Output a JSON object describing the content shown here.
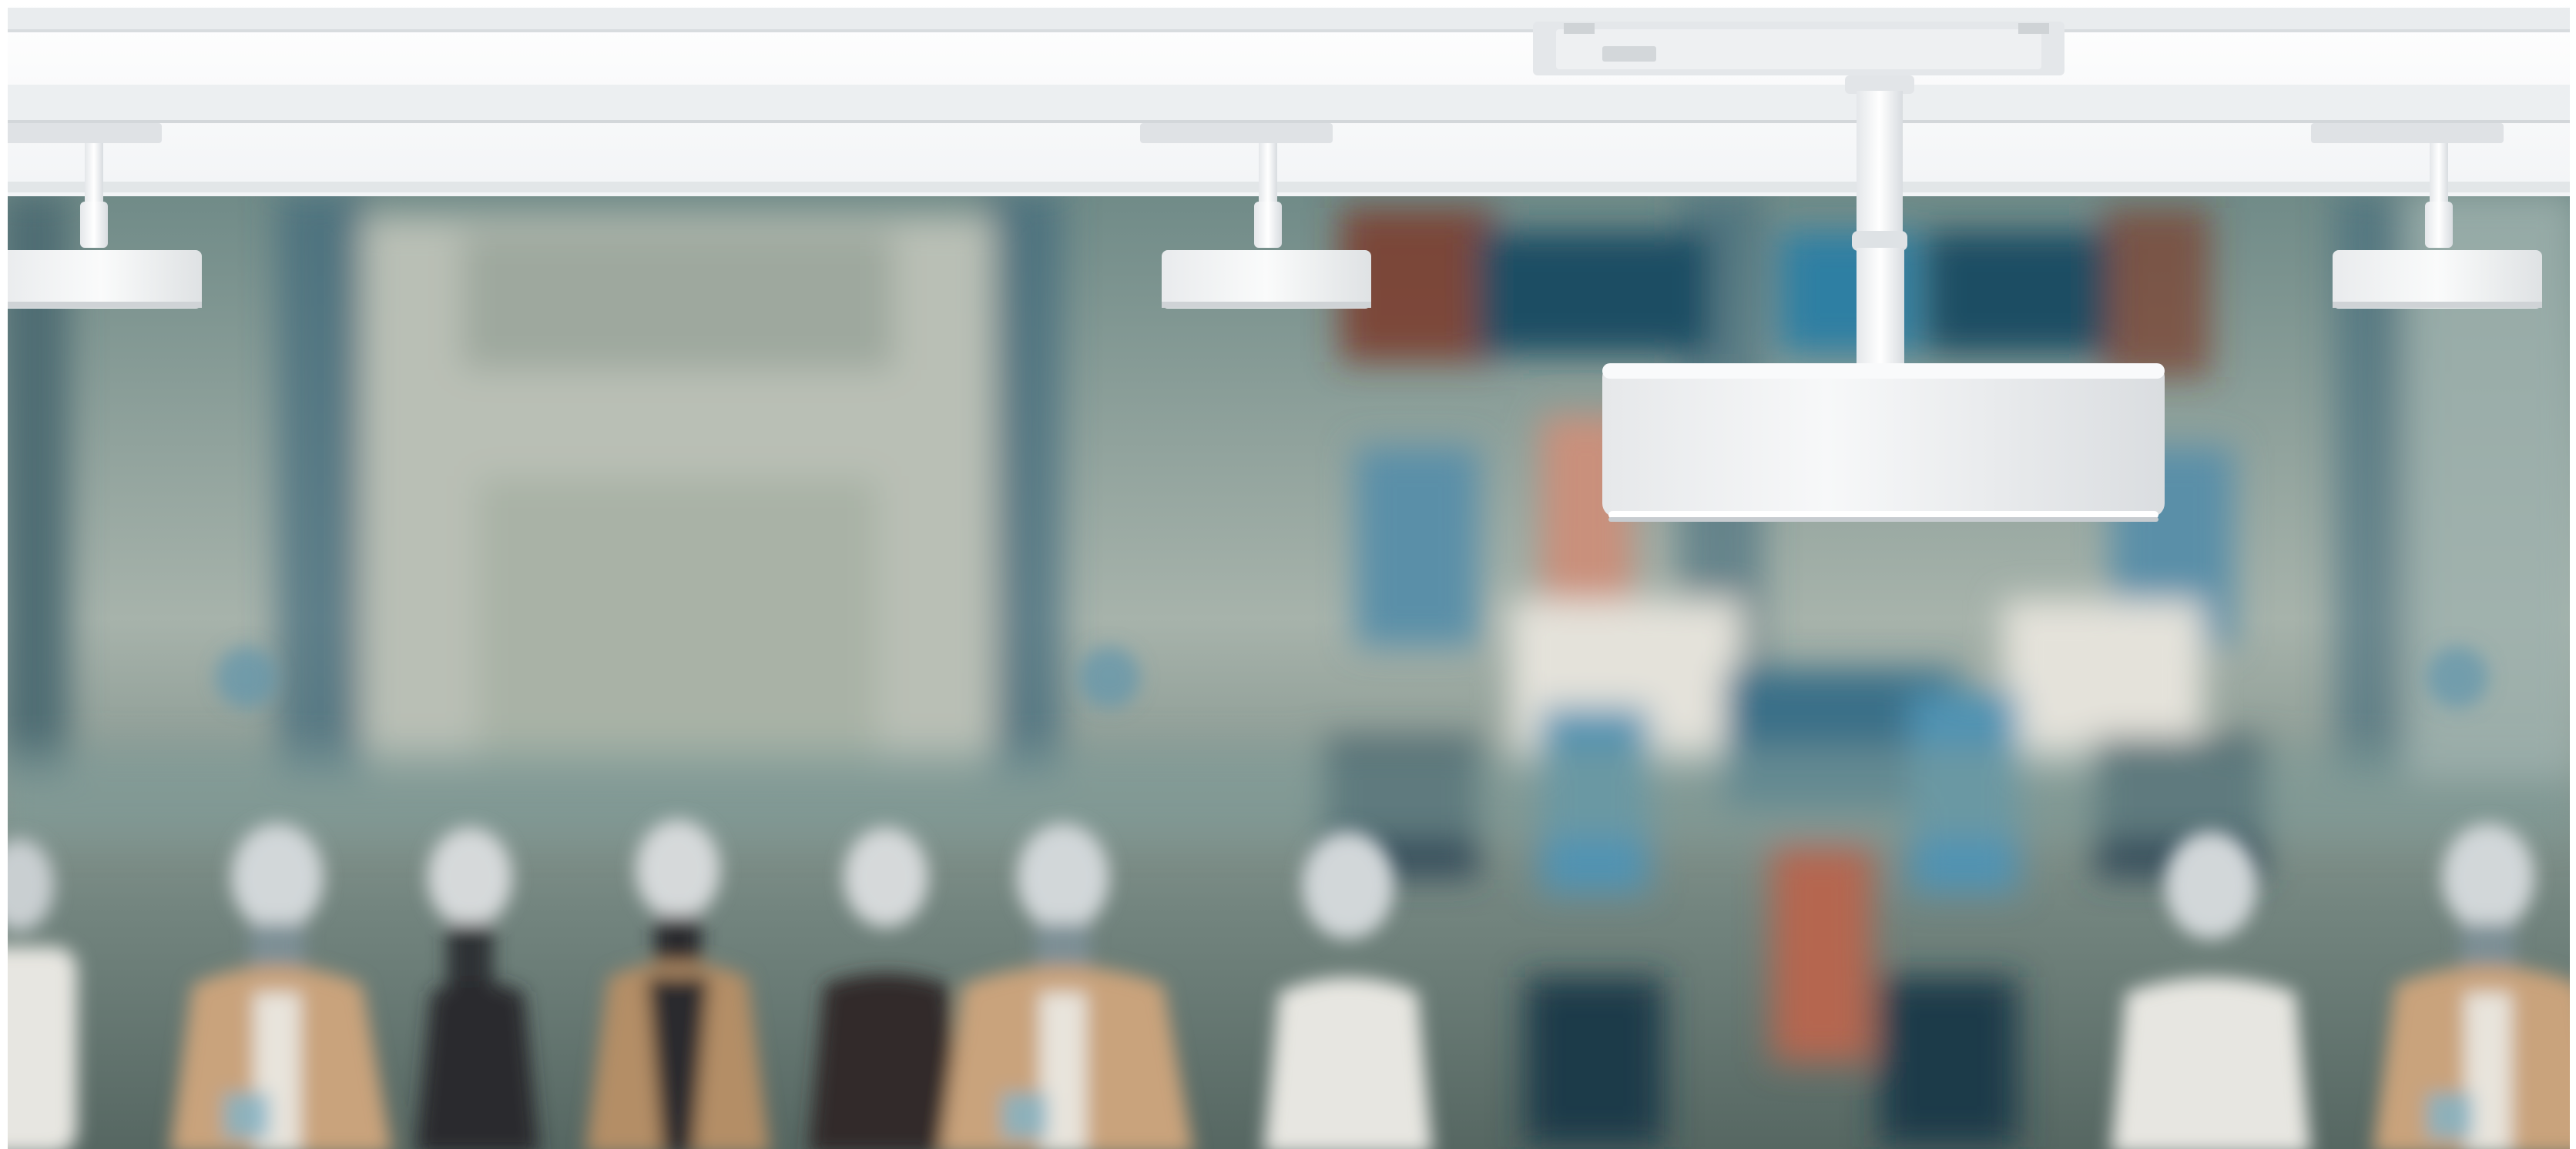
{
  "scene": {
    "background_color": "#ffffff",
    "ceiling_color": "#f4f6f7",
    "track_color": "#e9ecee",
    "fixture_color": "#f2f3f4",
    "fixture_shadow_color": "#cfd3d6",
    "store_wall_color": "#8c9d95",
    "store_floor_color": "#5b6f69",
    "accent_blue": "#2f6d86",
    "accent_rust": "#7b3b2a",
    "coat_tan": "#c9a37b",
    "coat_dark": "#2a2a2d",
    "coat_white": "#e7e6e1"
  },
  "icons": {
    "fixture": "spotlight-icon",
    "mannequin": "mannequin-icon"
  }
}
